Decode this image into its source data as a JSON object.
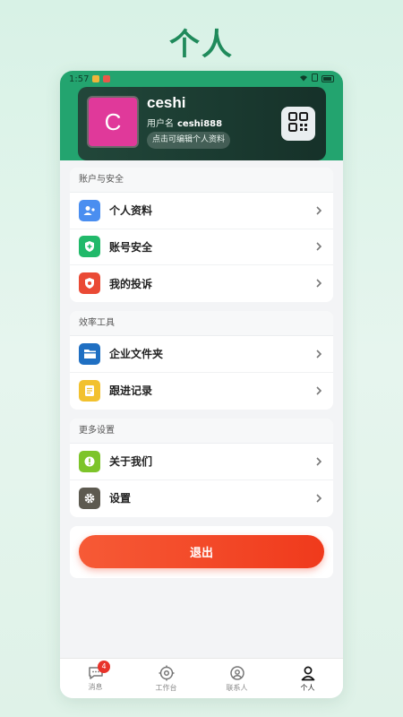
{
  "page_heading": "个人",
  "status_bar": {
    "time": "1:57"
  },
  "profile": {
    "avatar_letter": "C",
    "name": "ceshi",
    "id_label": "用户名",
    "id_value": "ceshi888",
    "edit_hint": "点击可编辑个人资料",
    "qr_icon": "qr-code-icon"
  },
  "sections": {
    "account": {
      "title": "账户与安全",
      "items": [
        {
          "label": "个人资料",
          "icon": "profile-icon",
          "color": "#4a8ef0"
        },
        {
          "label": "账号安全",
          "icon": "shield-icon",
          "color": "#21b96a"
        },
        {
          "label": "我的投诉",
          "icon": "complaint-icon",
          "color": "#ea4a35"
        }
      ]
    },
    "efficiency": {
      "title": "效率工具",
      "items": [
        {
          "label": "企业文件夹",
          "icon": "folder-icon",
          "color": "#1f6fc2"
        },
        {
          "label": "跟进记录",
          "icon": "record-icon",
          "color": "#f2c12e"
        }
      ]
    },
    "more": {
      "title": "更多设置",
      "items": [
        {
          "label": "关于我们",
          "icon": "info-icon",
          "color": "#7dc42a"
        },
        {
          "label": "设置",
          "icon": "gear-icon",
          "color": "#5d5a50"
        }
      ]
    }
  },
  "logout_label": "退出",
  "tabs": [
    {
      "label": "消息",
      "icon": "message-icon",
      "badge": "4"
    },
    {
      "label": "工作台",
      "icon": "workbench-icon"
    },
    {
      "label": "联系人",
      "icon": "contacts-icon"
    },
    {
      "label": "个人",
      "icon": "person-icon",
      "active": true
    }
  ]
}
